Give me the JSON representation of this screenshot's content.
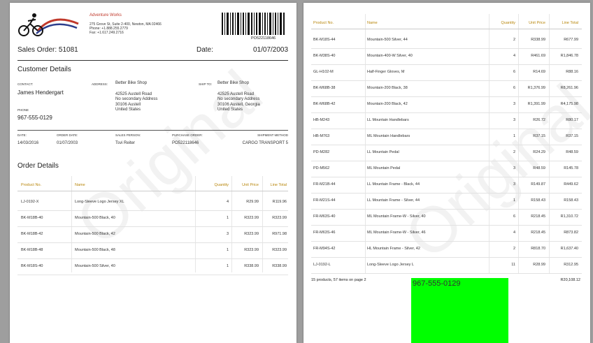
{
  "watermark": "Original",
  "company": {
    "name": "Adventure Works",
    "address": [
      "275 Grove St, Suite 2-400, Newton, MA 02466",
      "Phone: +1.888.255.2779",
      "Fax: +1.617.249.2716"
    ],
    "barcode_text": "PO522118646"
  },
  "order": {
    "title": "Sales Order: 51081",
    "date_label": "Date:",
    "date": "01/07/2003"
  },
  "customer_section": "Customer Details",
  "contact": {
    "label": "CONTACT:",
    "name": "James Hendergart",
    "phone_label": "PHONE",
    "phone": "967-555-0129"
  },
  "address": {
    "label": "ADDRESS:",
    "lines": [
      "Better Bike Shop",
      "42525 Austell Road",
      "No secondary Address",
      "30106 Austell",
      "United States"
    ]
  },
  "ship_to": {
    "label": "SHIP TO:",
    "lines": [
      "Better Bike Shop",
      "42525 Austell Road",
      "No secondary Address",
      "30106 Austell, Georgia",
      "United States"
    ]
  },
  "meta": {
    "labels": [
      "DATE:",
      "ORDER DATE:",
      "SALES PERSON:",
      "PURCHASE ORDER:",
      "SHIPMENT METHOD"
    ],
    "values": [
      "14/03/2016",
      "01/07/2003",
      "Tsvi Reiter",
      "PO522118646",
      "CARGO TRANSPORT 5"
    ]
  },
  "order_section": "Order Details",
  "columns": [
    "Product No.",
    "Name",
    "Quantity",
    "Unit Price",
    "Line Total"
  ],
  "rows_page1": [
    [
      "LJ-0192-X",
      "Long-Sleeve Logo Jersey XL",
      "4",
      "R29.99",
      "R119.96"
    ],
    [
      "BK-M18B-40",
      "Mountain-500 Black, 40",
      "1",
      "R323.99",
      "R323.99"
    ],
    [
      "BK-M18B-42",
      "Mountain-500 Black, 42",
      "3",
      "R323.99",
      "R971.98"
    ],
    [
      "BK-M18B-48",
      "Mountain-500 Black, 48",
      "1",
      "R323.99",
      "R323.99"
    ],
    [
      "BK-M18S-40",
      "Mountain-500 Silver, 40",
      "1",
      "R338.99",
      "R338.99"
    ]
  ],
  "rows_page2": [
    [
      "BK-M18S-44",
      "Mountain-500 Silver, 44",
      "2",
      "R338.99",
      "R677.99"
    ],
    [
      "BK-M38S-40",
      "Mountain-400-W Silver, 40",
      "4",
      "R461.69",
      "R1,846.78"
    ],
    [
      "GL-H102-M",
      "Half-Finger Gloves, M",
      "6",
      "R14.69",
      "R88.16"
    ],
    [
      "BK-M68B-38",
      "Mountain-200 Black, 38",
      "6",
      "R1,376.99",
      "R8,261.96"
    ],
    [
      "BK-M68B-42",
      "Mountain-200 Black, 42",
      "3",
      "R1,391.99",
      "R4,175.98"
    ],
    [
      "HB-M243",
      "LL Mountain Handlebars",
      "3",
      "R26.72",
      "R80.17"
    ],
    [
      "HB-M763",
      "ML Mountain Handlebars",
      "1",
      "R37.15",
      "R37.15"
    ],
    [
      "PD-M282",
      "LL Mountain Pedal",
      "2",
      "R24.29",
      "R48.59"
    ],
    [
      "PD-M562",
      "ML Mountain Pedal",
      "3",
      "R48.59",
      "R145.78"
    ],
    [
      "FR-M21B-44",
      "LL Mountain Frame - Black, 44",
      "3",
      "R149.87",
      "R449.62"
    ],
    [
      "FR-M21S-44",
      "LL Mountain Frame - Silver, 44",
      "1",
      "R158.43",
      "R158.43"
    ],
    [
      "FR-M63S-40",
      "ML Mountain Frame-W - Silver, 40",
      "6",
      "R218.45",
      "R1,310.72"
    ],
    [
      "FR-M63S-46",
      "ML Mountain Frame-W - Silver, 46",
      "4",
      "R218.45",
      "R873.82"
    ],
    [
      "FR-M94S-42",
      "HL Mountain Frame - Silver, 42",
      "2",
      "R818.70",
      "R1,637.40"
    ],
    [
      "LJ-0192-L",
      "Long-Sleeve Logo Jersey L",
      "11",
      "R28.99",
      "R312.95"
    ]
  ],
  "footer": {
    "summary": "15 products, 57 items on page 2",
    "total": "R20,108.12"
  },
  "green_box_phone": "967-555-0129"
}
